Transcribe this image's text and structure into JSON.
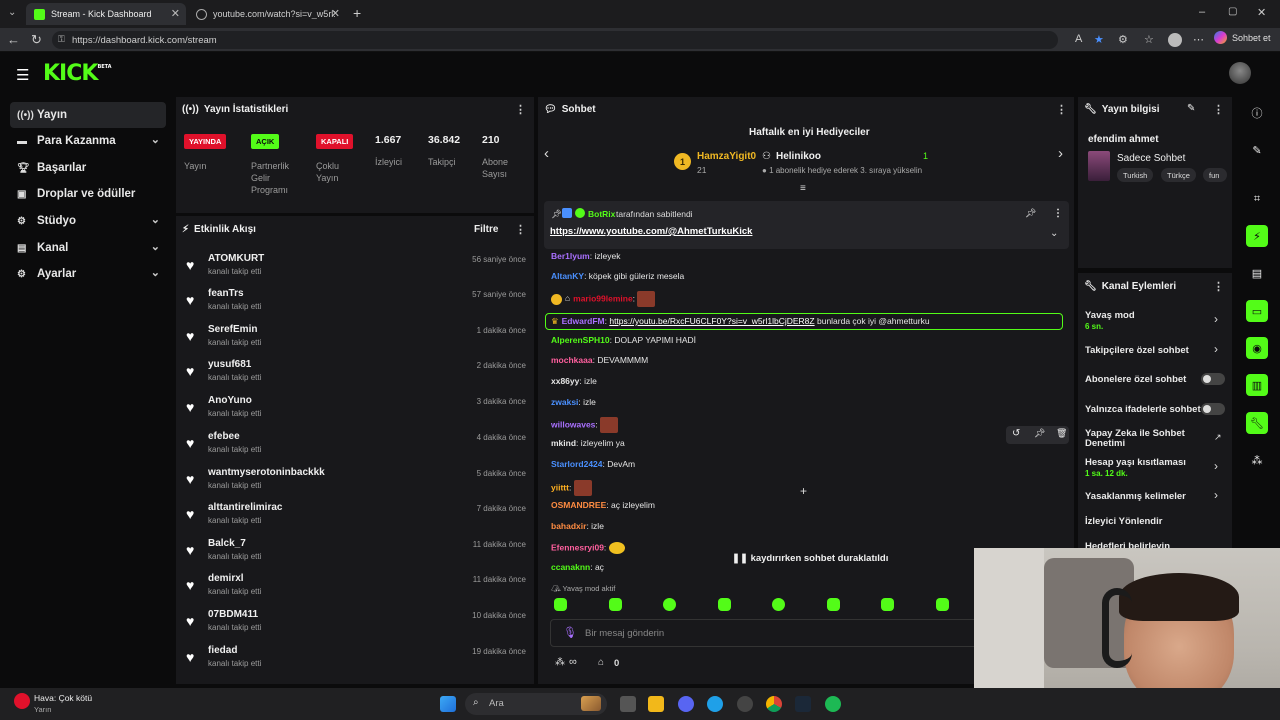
{
  "browser": {
    "tabs": [
      {
        "title": "Stream - Kick Dashboard"
      },
      {
        "title": "youtube.com/watch?si=v_w5rl1lbC"
      }
    ],
    "url": "https://dashboard.kick.com/stream",
    "copilot_label": "Sohbet et"
  },
  "header": {
    "logo": "KICK",
    "logo_sup": "BETA"
  },
  "sidebar": {
    "items": [
      {
        "label": "Yayın",
        "icon": "broadcast-icon"
      },
      {
        "label": "Para Kazanma",
        "icon": "money-icon"
      },
      {
        "label": "Başarılar",
        "icon": "trophy-icon"
      },
      {
        "label": "Droplar ve ödüller",
        "icon": "gift-icon"
      },
      {
        "label": "Stüdyo",
        "icon": "studio-icon"
      },
      {
        "label": "Kanal",
        "icon": "channel-icon"
      },
      {
        "label": "Ayarlar",
        "icon": "gear-icon"
      }
    ]
  },
  "stats": {
    "title": "Yayın İstatistikleri",
    "badges": [
      {
        "badge": "YAYINDA",
        "label": "Yayın",
        "color": "#e0112b"
      },
      {
        "badge": "AÇIK",
        "label": "Partnerlik Gelir Programı",
        "color": "#53fc18"
      },
      {
        "badge": "KAPALI",
        "label": "Çoklu Yayın",
        "color": "#e0112b"
      }
    ],
    "numbers": [
      {
        "value": "1.667",
        "label": "İzleyici"
      },
      {
        "value": "36.842",
        "label": "Takipçi"
      },
      {
        "value": "210",
        "label": "Abone Sayısı"
      }
    ]
  },
  "activity": {
    "title": "Etkinlik Akışı",
    "filter": "Filtre",
    "items": [
      {
        "name": "ATOMKURT",
        "action": "kanalı takip etti",
        "time": "56 saniye önce"
      },
      {
        "name": "feanTrs",
        "action": "kanalı takip etti",
        "time": "57 saniye önce"
      },
      {
        "name": "SerefEmin",
        "action": "kanalı takip etti",
        "time": "1 dakika önce"
      },
      {
        "name": "yusuf681",
        "action": "kanalı takip etti",
        "time": "2 dakika önce"
      },
      {
        "name": "AnoYuno",
        "action": "kanalı takip etti",
        "time": "3 dakika önce"
      },
      {
        "name": "efebee",
        "action": "kanalı takip etti",
        "time": "4 dakika önce"
      },
      {
        "name": "wantmyserotoninbackkk",
        "action": "kanalı takip etti",
        "time": "5 dakika önce"
      },
      {
        "name": "alttantirelimirac",
        "action": "kanalı takip etti",
        "time": "7 dakika önce"
      },
      {
        "name": "Balck_7",
        "action": "kanalı takip etti",
        "time": "11 dakika önce"
      },
      {
        "name": "demirxl",
        "action": "kanalı takip etti",
        "time": "11 dakika önce"
      },
      {
        "name": "07BDM411",
        "action": "kanalı takip etti",
        "time": "10 dakika önce"
      },
      {
        "name": "fiedad",
        "action": "kanalı takip etti",
        "time": "19 dakika önce"
      }
    ]
  },
  "chat": {
    "title": "Sohbet",
    "gifters_title": "Haftalık en iyi Hediyeciler",
    "top_gifter": {
      "rank": "1",
      "name": "HamzaYigit0",
      "count": "21"
    },
    "second_gifter": {
      "name": "Helinikoo",
      "count": "1",
      "note": "1 abonelik hediye ederek 3. sıraya yükselin"
    },
    "pinned": {
      "by_user": "BotRix",
      "by_text": "tarafından sabitlendi",
      "link": "https://www.youtube.com/@AhmetTurkuKick"
    },
    "messages": [
      {
        "user": "Ber1lyum",
        "text": ": izleyek",
        "color": "#a970ff"
      },
      {
        "user": "AltanKY",
        "text": ": köpek gibi güleriz mesela",
        "color": "#4a90ff"
      },
      {
        "user": "mario99lemine",
        "text": ":",
        "color": "#e0112b"
      },
      {
        "user": "EdwardFM",
        "text": "bunlarda çok iyi @ahmetturku",
        "color": "#a970ff",
        "link": "https://youtu.be/RxcFU6CLF0Y?si=v_w5rl1lbCjDER8Z"
      },
      {
        "user": "AlperenSPH10",
        "text": ": DOLAP YAPIMI HADİ",
        "color": "#53fc18"
      },
      {
        "user": "mochkaaa",
        "text": ": DEVAMMMM",
        "color": "#ff5f9e"
      },
      {
        "user": "xx86yy",
        "text": ": izle",
        "color": "#e6e6e6"
      },
      {
        "user": "zwaksi",
        "text": ": izle",
        "color": "#4a90ff"
      },
      {
        "user": "willowaves",
        "text": ":",
        "color": "#a970ff"
      },
      {
        "user": "mkind",
        "text": ": izleyelim ya",
        "color": "#e6e6e6"
      },
      {
        "user": "Starlord2424",
        "text": ": DevAm",
        "color": "#4a90ff"
      },
      {
        "user": "yiittt",
        "text": ":",
        "color": "#ffb020"
      },
      {
        "user": "OSMANDREE",
        "text": ": aç izleyelim",
        "color": "#ff8c42"
      },
      {
        "user": "bahadxir",
        "text": ": izle",
        "color": "#ff8c42"
      },
      {
        "user": "Efennesryi09",
        "text": ":",
        "color": "#ff5f9e"
      },
      {
        "user": "ccanaknn",
        "text": ": aç",
        "color": "#53fc18"
      }
    ],
    "paused_text": "kaydırırken sohbet duraklatıldı",
    "slow_mode_text": "Yavaş mod aktif",
    "input_placeholder": "Bir mesaj gönderin",
    "footer_infinity": "∞",
    "footer_count": "0"
  },
  "stream_info": {
    "title": "Yayın bilgisi",
    "stream_title": "efendim ahmet",
    "category": "Sadece Sohbet",
    "tags": [
      "Turkish",
      "Türkçe",
      "fun"
    ]
  },
  "channel_actions": {
    "title": "Kanal Eylemleri",
    "items": [
      {
        "label": "Yavaş mod",
        "sub": "6 sn.",
        "control": "chevron"
      },
      {
        "label": "Takipçilere özel sohbet",
        "control": "chevron"
      },
      {
        "label": "Abonelere özel sohbet",
        "control": "toggle"
      },
      {
        "label": "Yalnızca ifadelerle sohbet",
        "control": "toggle"
      },
      {
        "label": "Yapay Zeka ile Sohbet Denetimi",
        "control": "external"
      },
      {
        "label": "Hesap yaşı kısıtlaması",
        "sub": "1 sa. 12 dk.",
        "control": "chevron"
      },
      {
        "label": "Yasaklanmış kelimeler",
        "control": "chevron"
      },
      {
        "label": "İzleyici Yönlendir",
        "control": "none"
      },
      {
        "label": "Hedefleri belirleyin",
        "control": "chevron"
      }
    ]
  },
  "taskbar": {
    "weather_title": "Hava: Çok kötü",
    "weather_sub": "Yarın",
    "search": "Ara"
  },
  "colors": {
    "accent": "#53fc18",
    "live": "#e0112b",
    "panel": "#18181b",
    "bg": "#0b0b0c"
  }
}
